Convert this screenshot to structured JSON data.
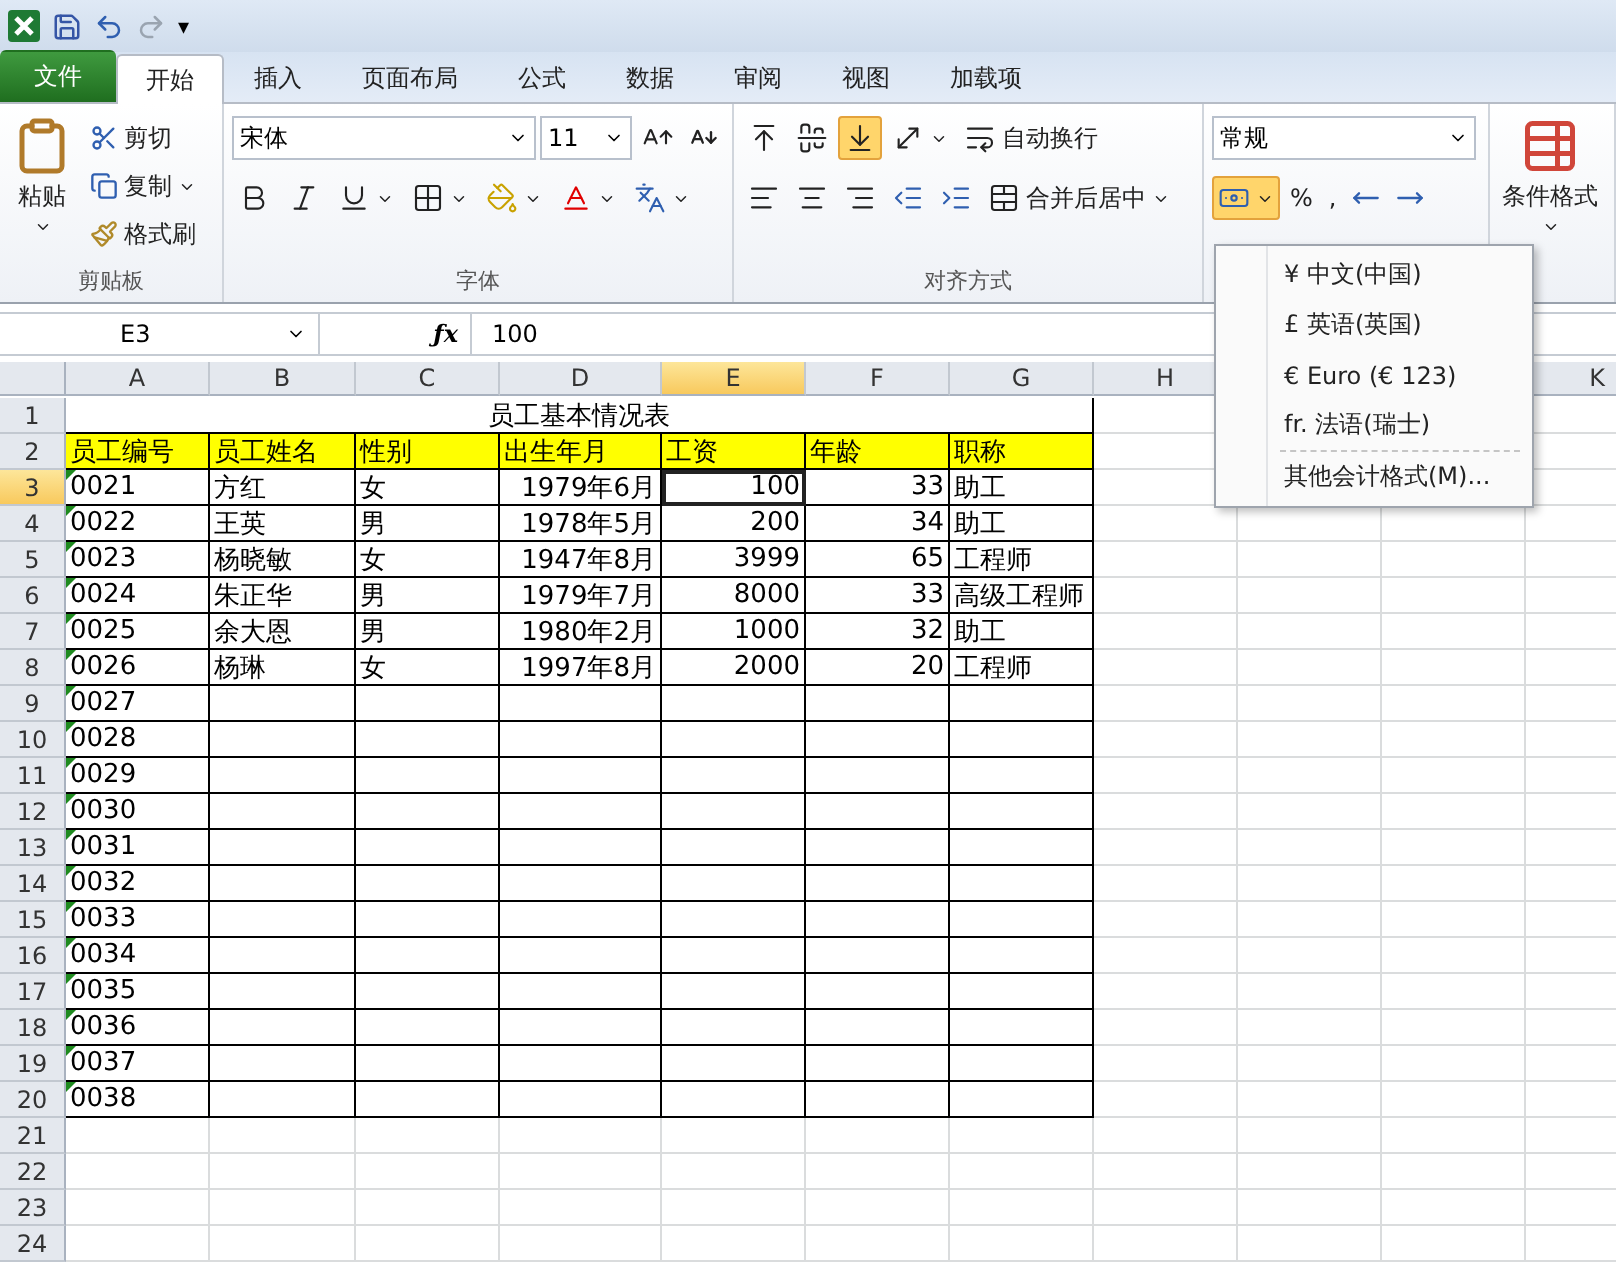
{
  "quick_access": {
    "customize": "▾"
  },
  "tabs": [
    {
      "label": "文件",
      "kind": "file",
      "selected": false
    },
    {
      "label": "开始",
      "kind": "tab",
      "selected": true
    },
    {
      "label": "插入",
      "kind": "tab",
      "selected": false
    },
    {
      "label": "页面布局",
      "kind": "tab",
      "selected": false
    },
    {
      "label": "公式",
      "kind": "tab",
      "selected": false
    },
    {
      "label": "数据",
      "kind": "tab",
      "selected": false
    },
    {
      "label": "审阅",
      "kind": "tab",
      "selected": false
    },
    {
      "label": "视图",
      "kind": "tab",
      "selected": false
    },
    {
      "label": "加载项",
      "kind": "tab",
      "selected": false
    }
  ],
  "ribbon": {
    "clipboard": {
      "label": "剪贴板",
      "paste": "粘贴",
      "cut": "剪切",
      "copy": "复制",
      "format_painter": "格式刷"
    },
    "font": {
      "label": "字体",
      "font_name": "宋体",
      "font_size": "11"
    },
    "alignment": {
      "label": "对齐方式",
      "vertical": [
        {
          "selected": false
        },
        {
          "selected": false
        },
        {
          "selected": true
        }
      ],
      "wrap_text": "自动换行",
      "merge_center": "合并后居中"
    },
    "number": {
      "format": "常规",
      "accounting_selected": true,
      "percent": "%",
      "comma": ","
    },
    "styles": {
      "conditional_formatting": "条件格式"
    }
  },
  "formula_bar": {
    "name_box": "E3",
    "function_label": "ƒx",
    "value": "100"
  },
  "sheet": {
    "columns": [
      {
        "label": "A",
        "selected": false
      },
      {
        "label": "B",
        "selected": false
      },
      {
        "label": "C",
        "selected": false
      },
      {
        "label": "D",
        "selected": false
      },
      {
        "label": "E",
        "selected": true
      },
      {
        "label": "F",
        "selected": false
      },
      {
        "label": "G",
        "selected": false
      },
      {
        "label": "H",
        "selected": false
      },
      {
        "label": "K",
        "selected": false
      }
    ],
    "rows": [
      {
        "number": "1",
        "kind": "title",
        "selected": false,
        "flagged": false,
        "cells": [
          "员工基本情况表"
        ]
      },
      {
        "number": "2",
        "kind": "header",
        "selected": false,
        "flagged": false,
        "cells": [
          "员工编号",
          "员工姓名",
          "性别",
          "出生年月",
          "工资",
          "年龄",
          "职称"
        ]
      },
      {
        "number": "3",
        "kind": "data",
        "selected": true,
        "flagged": true,
        "cells": [
          "0021",
          "方红",
          "女",
          "1979年6月",
          "100",
          "33",
          "助工"
        ]
      },
      {
        "number": "4",
        "kind": "data",
        "selected": false,
        "flagged": true,
        "cells": [
          "0022",
          "王英",
          "男",
          "1978年5月",
          "200",
          "34",
          "助工"
        ]
      },
      {
        "number": "5",
        "kind": "data",
        "selected": false,
        "flagged": true,
        "cells": [
          "0023",
          "杨晓敏",
          "女",
          "1947年8月",
          "3999",
          "65",
          "工程师"
        ]
      },
      {
        "number": "6",
        "kind": "data",
        "selected": false,
        "flagged": true,
        "cells": [
          "0024",
          "朱正华",
          "男",
          "1979年7月",
          "8000",
          "33",
          "高级工程师"
        ]
      },
      {
        "number": "7",
        "kind": "data",
        "selected": false,
        "flagged": true,
        "cells": [
          "0025",
          "余大恩",
          "男",
          "1980年2月",
          "1000",
          "32",
          "助工"
        ]
      },
      {
        "number": "8",
        "kind": "data",
        "selected": false,
        "flagged": true,
        "cells": [
          "0026",
          "杨琳",
          "女",
          "1997年8月",
          "2000",
          "20",
          "工程师"
        ]
      },
      {
        "number": "9",
        "kind": "data",
        "selected": false,
        "flagged": true,
        "cells": [
          "0027"
        ]
      },
      {
        "number": "10",
        "kind": "data",
        "selected": false,
        "flagged": true,
        "cells": [
          "0028"
        ]
      },
      {
        "number": "11",
        "kind": "data",
        "selected": false,
        "flagged": true,
        "cells": [
          "0029"
        ]
      },
      {
        "number": "12",
        "kind": "data",
        "selected": false,
        "flagged": true,
        "cells": [
          "0030"
        ]
      },
      {
        "number": "13",
        "kind": "data",
        "selected": false,
        "flagged": true,
        "cells": [
          "0031"
        ]
      },
      {
        "number": "14",
        "kind": "data",
        "selected": false,
        "flagged": true,
        "cells": [
          "0032"
        ]
      },
      {
        "number": "15",
        "kind": "data",
        "selected": false,
        "flagged": true,
        "cells": [
          "0033"
        ]
      },
      {
        "number": "16",
        "kind": "data",
        "selected": false,
        "flagged": true,
        "cells": [
          "0034"
        ]
      },
      {
        "number": "17",
        "kind": "data",
        "selected": false,
        "flagged": true,
        "cells": [
          "0035"
        ]
      },
      {
        "number": "18",
        "kind": "data",
        "selected": false,
        "flagged": true,
        "cells": [
          "0036"
        ]
      },
      {
        "number": "19",
        "kind": "data",
        "selected": false,
        "flagged": true,
        "cells": [
          "0037"
        ]
      },
      {
        "number": "20",
        "kind": "data",
        "selected": false,
        "flagged": true,
        "cells": [
          "0038"
        ]
      },
      {
        "number": "21",
        "kind": "empty",
        "selected": false,
        "flagged": false
      },
      {
        "number": "22",
        "kind": "empty",
        "selected": false,
        "flagged": false
      },
      {
        "number": "23",
        "kind": "empty",
        "selected": false,
        "flagged": false
      },
      {
        "number": "24",
        "kind": "empty",
        "selected": false,
        "flagged": false
      }
    ]
  },
  "currency_menu": {
    "items": [
      {
        "kind": "item",
        "label": "¥ 中文(中国)"
      },
      {
        "kind": "item",
        "label": "£ 英语(英国)"
      },
      {
        "kind": "item",
        "label": "€ Euro (€ 123)"
      },
      {
        "kind": "item",
        "label": "fr. 法语(瑞士)"
      },
      {
        "kind": "separator"
      },
      {
        "kind": "item",
        "label": "其他会计格式(M)..."
      }
    ]
  }
}
